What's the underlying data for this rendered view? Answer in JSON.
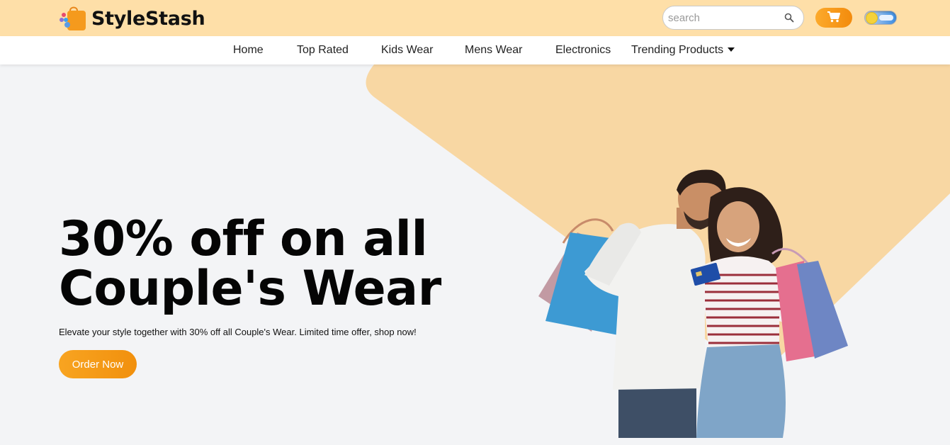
{
  "header": {
    "brand_name": "StyleStash",
    "logo_icon": "shopping-bag-icon",
    "search": {
      "placeholder": "search",
      "value": "",
      "icon": "search-icon"
    },
    "cart_icon": "cart-icon",
    "theme_toggle": {
      "state": "light"
    }
  },
  "nav": {
    "items": [
      {
        "label": "Home"
      },
      {
        "label": "Top Rated"
      },
      {
        "label": "Kids Wear"
      },
      {
        "label": "Mens Wear"
      },
      {
        "label": "Electronics"
      },
      {
        "label": "Trending Products",
        "has_dropdown": true
      }
    ]
  },
  "hero": {
    "headline_line1": "30% off on all",
    "headline_line2": "Couple's Wear",
    "subtext": "Elevate your style together with 30% off all Couple's Wear. Limited time offer, shop now!",
    "cta_label": "Order Now",
    "image_alt": "couple-with-shopping-bags"
  },
  "colors": {
    "topbar_bg": "#fedfa8",
    "accent_orange": "#f39a16",
    "hero_shape": "#f8d7a3",
    "page_bg": "#f3f4f6"
  }
}
